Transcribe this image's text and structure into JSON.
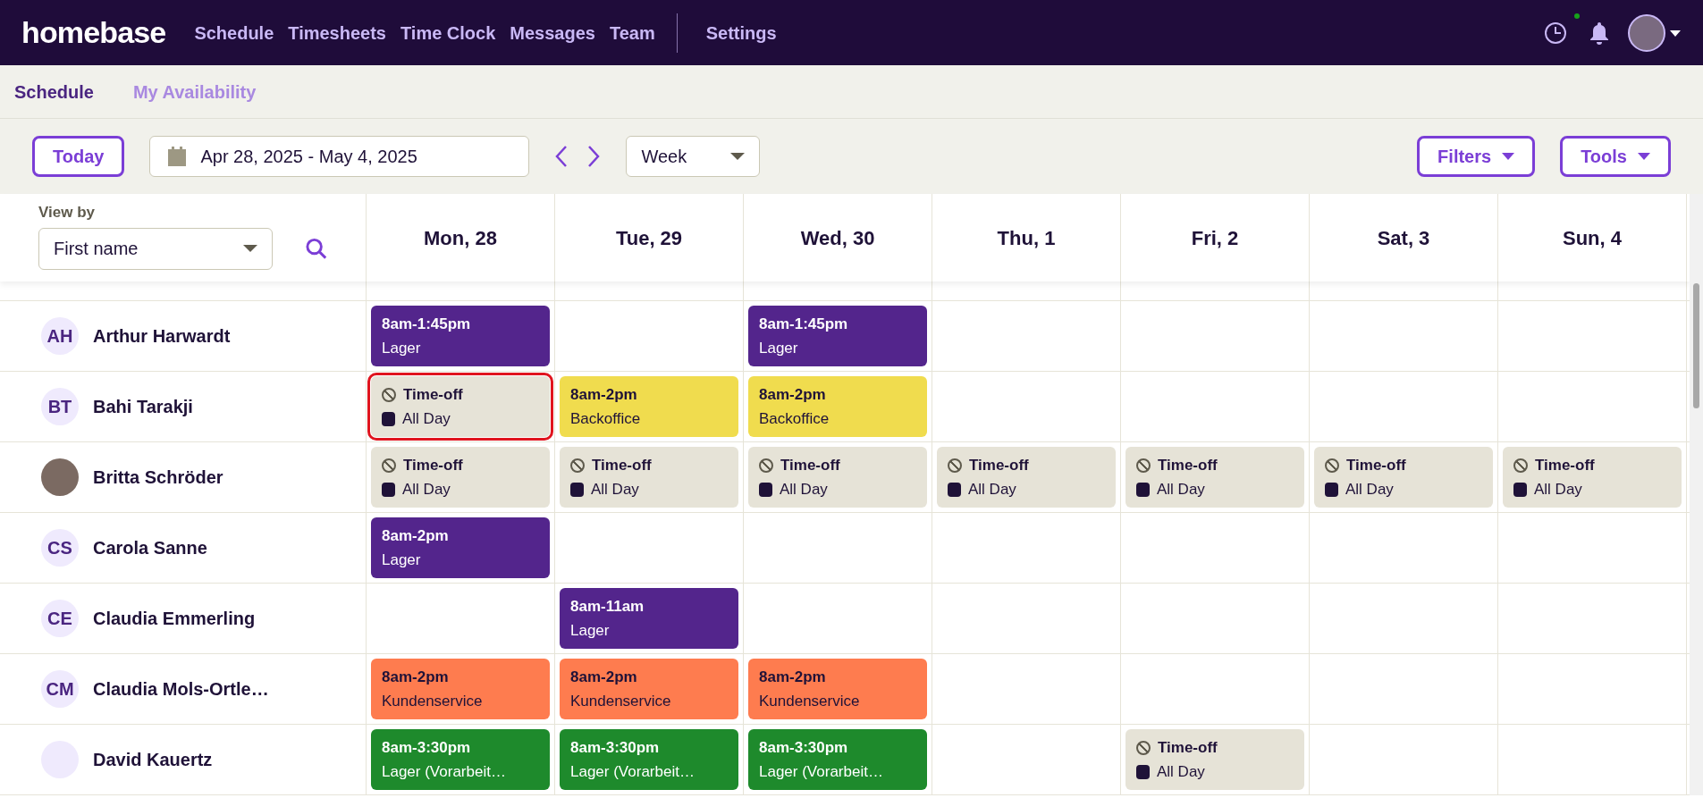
{
  "brand": "homebase",
  "nav": [
    "Schedule",
    "Timesheets",
    "Time Clock",
    "Messages",
    "Team"
  ],
  "nav_secondary": [
    "Settings"
  ],
  "subnav": [
    {
      "label": "Schedule",
      "selected": true
    },
    {
      "label": "My Availability",
      "selected": false
    }
  ],
  "toolbar": {
    "today": "Today",
    "date_range": "Apr 28, 2025 - May 4, 2025",
    "view": "Week",
    "filters": "Filters",
    "tools": "Tools"
  },
  "view_by": {
    "label": "View by",
    "value": "First name"
  },
  "days": [
    "Mon, 28",
    "Tue, 29",
    "Wed, 30",
    "Thu, 1",
    "Fri, 2",
    "Sat, 3",
    "Sun, 4"
  ],
  "rows": [
    {
      "name": "Arthur Harwardt",
      "avatar": {
        "kind": "initials",
        "text": "AH"
      },
      "cells": [
        {
          "kind": "shift",
          "time": "8am-1:45pm",
          "role": "Lager",
          "color": "#53258c",
          "selected": false
        },
        {
          "kind": "empty"
        },
        {
          "kind": "shift",
          "time": "8am-1:45pm",
          "role": "Lager",
          "color": "#53258c",
          "selected": false
        },
        {
          "kind": "empty"
        },
        {
          "kind": "empty"
        },
        {
          "kind": "empty"
        },
        {
          "kind": "empty"
        }
      ]
    },
    {
      "name": "Bahi Tarakji",
      "avatar": {
        "kind": "initials",
        "text": "BT"
      },
      "cells": [
        {
          "kind": "timeoff",
          "title": "Time-off",
          "duration": "All Day",
          "selected": true
        },
        {
          "kind": "shift",
          "time": "8am-2pm",
          "role": "Backoffice",
          "color": "#f0dc4e",
          "selected": false
        },
        {
          "kind": "shift",
          "time": "8am-2pm",
          "role": "Backoffice",
          "color": "#f0dc4e",
          "selected": false
        },
        {
          "kind": "empty"
        },
        {
          "kind": "empty"
        },
        {
          "kind": "empty"
        },
        {
          "kind": "empty"
        }
      ]
    },
    {
      "name": "Britta Schröder",
      "avatar": {
        "kind": "photo"
      },
      "cells": [
        {
          "kind": "timeoff",
          "title": "Time-off",
          "duration": "All Day",
          "selected": false
        },
        {
          "kind": "timeoff",
          "title": "Time-off",
          "duration": "All Day",
          "selected": false
        },
        {
          "kind": "timeoff",
          "title": "Time-off",
          "duration": "All Day",
          "selected": false
        },
        {
          "kind": "timeoff",
          "title": "Time-off",
          "duration": "All Day",
          "selected": false
        },
        {
          "kind": "timeoff",
          "title": "Time-off",
          "duration": "All Day",
          "selected": false
        },
        {
          "kind": "timeoff",
          "title": "Time-off",
          "duration": "All Day",
          "selected": false
        },
        {
          "kind": "timeoff",
          "title": "Time-off",
          "duration": "All Day",
          "selected": false
        }
      ]
    },
    {
      "name": "Carola Sanne",
      "avatar": {
        "kind": "initials",
        "text": "CS"
      },
      "cells": [
        {
          "kind": "shift",
          "time": "8am-2pm",
          "role": "Lager",
          "color": "#53258c",
          "selected": false
        },
        {
          "kind": "empty"
        },
        {
          "kind": "empty"
        },
        {
          "kind": "empty"
        },
        {
          "kind": "empty"
        },
        {
          "kind": "empty"
        },
        {
          "kind": "empty"
        }
      ]
    },
    {
      "name": "Claudia Emmerling",
      "avatar": {
        "kind": "initials",
        "text": "CE"
      },
      "cells": [
        {
          "kind": "empty"
        },
        {
          "kind": "shift",
          "time": "8am-11am",
          "role": "Lager",
          "color": "#53258c",
          "selected": false
        },
        {
          "kind": "empty"
        },
        {
          "kind": "empty"
        },
        {
          "kind": "empty"
        },
        {
          "kind": "empty"
        },
        {
          "kind": "empty"
        }
      ]
    },
    {
      "name": "Claudia Mols-Ortle…",
      "avatar": {
        "kind": "initials",
        "text": "CM"
      },
      "cells": [
        {
          "kind": "shift",
          "time": "8am-2pm",
          "role": "Kundenservice",
          "color": "#fe7c4f",
          "selected": false
        },
        {
          "kind": "shift",
          "time": "8am-2pm",
          "role": "Kundenservice",
          "color": "#fe7c4f",
          "selected": false
        },
        {
          "kind": "shift",
          "time": "8am-2pm",
          "role": "Kundenservice",
          "color": "#fe7c4f",
          "selected": false
        },
        {
          "kind": "empty"
        },
        {
          "kind": "empty"
        },
        {
          "kind": "empty"
        },
        {
          "kind": "empty"
        }
      ]
    },
    {
      "name": "David Kauertz",
      "avatar": {
        "kind": "blank"
      },
      "cells": [
        {
          "kind": "shift",
          "time": "8am-3:30pm",
          "role": "Lager (Vorarbeit…",
          "color": "#1e8a2c",
          "selected": false
        },
        {
          "kind": "shift",
          "time": "8am-3:30pm",
          "role": "Lager (Vorarbeit…",
          "color": "#1e8a2c",
          "selected": false
        },
        {
          "kind": "shift",
          "time": "8am-3:30pm",
          "role": "Lager (Vorarbeit…",
          "color": "#1e8a2c",
          "selected": false
        },
        {
          "kind": "empty"
        },
        {
          "kind": "timeoff",
          "title": "Time-off",
          "duration": "All Day",
          "selected": false
        },
        {
          "kind": "empty"
        },
        {
          "kind": "empty"
        }
      ]
    }
  ]
}
